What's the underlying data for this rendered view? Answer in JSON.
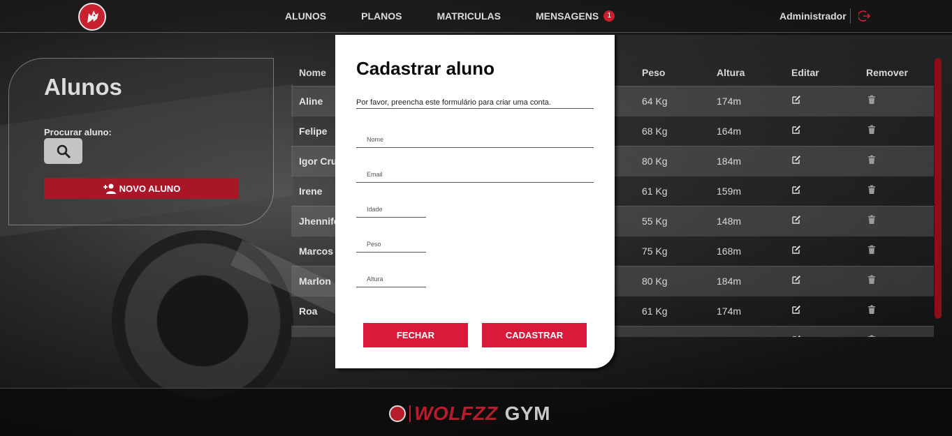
{
  "header": {
    "nav": [
      {
        "label": "ALUNOS"
      },
      {
        "label": "PLANOS"
      },
      {
        "label": "MATRICULAS"
      },
      {
        "label": "MENSAGENS",
        "badge": "1"
      }
    ],
    "user": "Administrador"
  },
  "panel": {
    "title": "Alunos",
    "search_label": "Procurar aluno:",
    "new_button": "NOVO ALUNO"
  },
  "table": {
    "headers": {
      "name": "Nome",
      "weight": "Peso",
      "height": "Altura",
      "edit": "Editar",
      "remove": "Remover"
    },
    "rows": [
      {
        "name": "Aline",
        "weight": "64 Kg",
        "height": "174m"
      },
      {
        "name": "Felipe",
        "weight": "68 Kg",
        "height": "164m"
      },
      {
        "name": "Igor Cru",
        "weight": "80 Kg",
        "height": "184m"
      },
      {
        "name": "Irene",
        "weight": "61 Kg",
        "height": "159m"
      },
      {
        "name": "Jhennife",
        "weight": "55 Kg",
        "height": "148m"
      },
      {
        "name": "Marcos",
        "weight": "75 Kg",
        "height": "168m"
      },
      {
        "name": "Marlon",
        "weight": "80 Kg",
        "height": "184m"
      },
      {
        "name": "Roa",
        "weight": "61 Kg",
        "height": "174m"
      }
    ]
  },
  "modal": {
    "title": "Cadastrar aluno",
    "subtitle": "Por favor, preencha este formulário para criar uma conta.",
    "fields": {
      "name": {
        "placeholder": "Nome"
      },
      "email": {
        "placeholder": "Email"
      },
      "age": {
        "placeholder": "Idade"
      },
      "weight": {
        "placeholder": "Peso"
      },
      "height": {
        "placeholder": "Altura"
      }
    },
    "close_button": "FECHAR",
    "submit_button": "CADASTRAR"
  },
  "footer": {
    "brand_a": "WOLFZZ",
    "brand_b": "GYM"
  },
  "colors": {
    "accent": "#d91a3a",
    "accent_dark": "#a81628",
    "badge": "#c8202f"
  },
  "icons": [
    "wolf-logo-icon",
    "logout-icon",
    "search-icon",
    "add-user-icon",
    "edit-icon",
    "trash-icon"
  ]
}
